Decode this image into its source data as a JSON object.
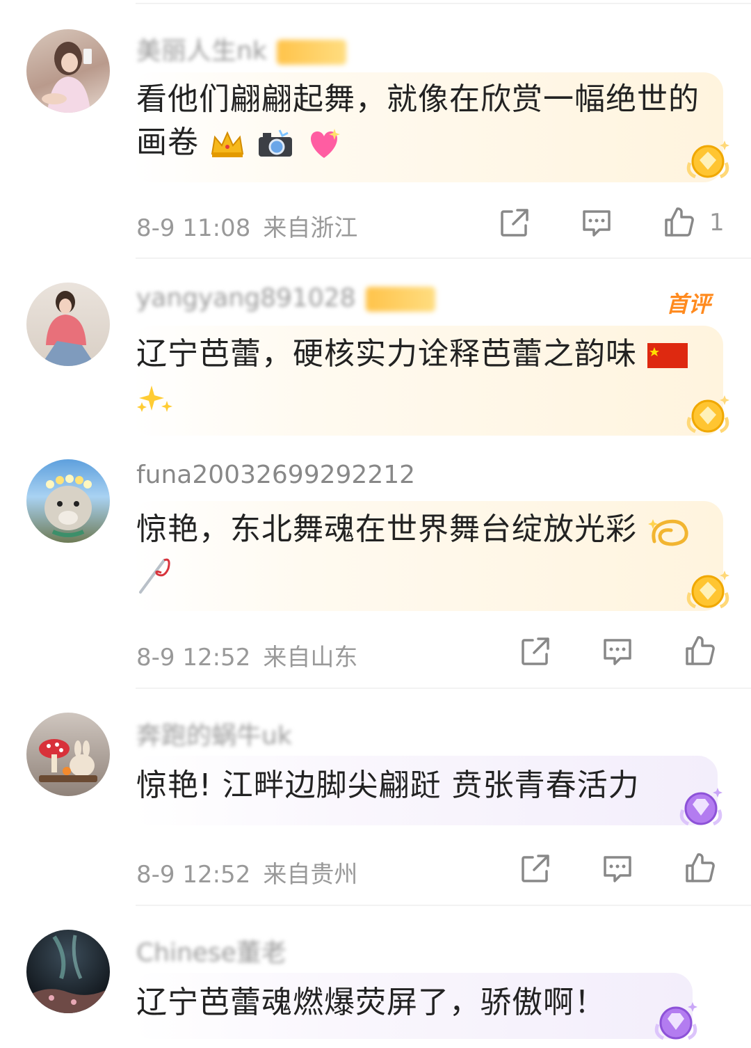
{
  "comments": [
    {
      "username": "美丽人生nk",
      "text": "看他们翩翩起舞，就像在欣赏一幅绝世的画卷",
      "emojis": [
        "crown-icon",
        "camera-flash-icon",
        "sparkling-heart-icon"
      ],
      "date": "8-9 11:08",
      "location": "来自浙江",
      "likes": "1",
      "medal_color": "#ffc531"
    },
    {
      "username": "yangyang891028",
      "first_label": "首评",
      "text": "辽宁芭蕾，硬核实力诠释芭蕾之韵味",
      "emojis": [
        "china-flag-icon",
        "sparkles-icon"
      ],
      "medal_color": "#ffc531"
    },
    {
      "username": "funa20032699292212",
      "text": "惊艳，东北舞魂在世界舞台绽放光彩",
      "emojis": [
        "dizzy-icon",
        "needle-thread-icon"
      ],
      "date": "8-9 12:52",
      "location": "来自山东",
      "medal_color": "#ffc531"
    },
    {
      "username": "奔跑的蜗牛uk",
      "text": "惊艳! 江畔边脚尖翩跹 贲张青春活力",
      "date": "8-9 12:52",
      "location": "来自贵州",
      "medal_color": "#b37cf0"
    },
    {
      "username": "Chinese董老",
      "text": "辽宁芭蕾魂燃爆荧屏了，骄傲啊！",
      "medal_color": "#b37cf0"
    }
  ]
}
